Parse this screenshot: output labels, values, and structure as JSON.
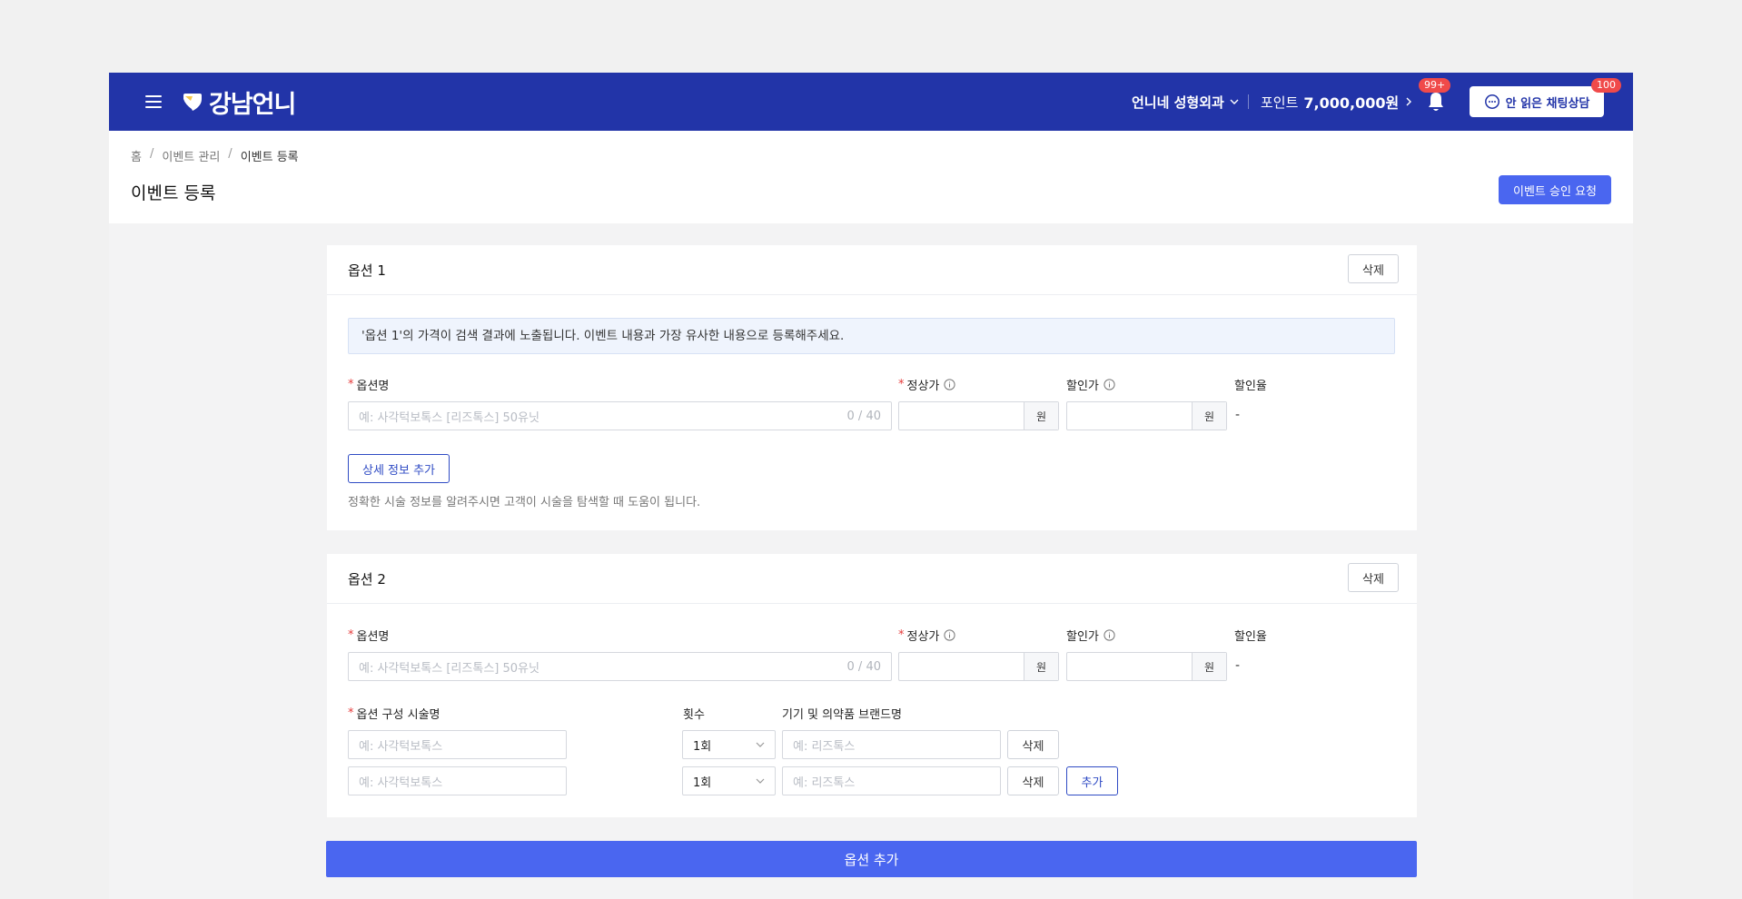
{
  "app": {
    "logo_text": "강남언니",
    "hospital_name": "언니네 성형외과",
    "points_label": "포인트",
    "points_value": "7,000,000원",
    "notifications_badge": "99+",
    "chat_button_label": "안 읽은 채팅상담",
    "chat_badge": "100",
    "accent_color": "#2234a8",
    "primary_button_color": "#4a66f0"
  },
  "breadcrumb": [
    "홈",
    "이벤트 관리",
    "이벤트 등록"
  ],
  "page": {
    "title": "이벤트 등록",
    "approve_button": "이벤트 승인 요청"
  },
  "option1": {
    "title": "옵션 1",
    "delete_label": "삭제",
    "notice": "'옵션 1'의 가격이 검색 결과에 노출됩니다. 이벤트 내용과 가장 유사한 내용으로 등록해주세요.",
    "name_label": "옵션명",
    "name_placeholder": "예: 사각턱보톡스 [리즈톡스] 50유닛",
    "name_counter": "0 / 40",
    "regular_price_label": "정상가",
    "discount_price_label": "할인가",
    "discount_rate_label": "할인율",
    "currency_unit": "원",
    "discount_rate_value": "-",
    "detail_button": "상세 정보 추가",
    "helper_text": "정확한 시술 정보를 알려주시면 고객이 시술을 탐색할 때 도움이 됩니다."
  },
  "option2": {
    "title": "옵션 2",
    "delete_label": "삭제",
    "name_label": "옵션명",
    "name_placeholder": "예: 사각턱보톡스 [리즈톡스] 50유닛",
    "name_counter": "0 / 40",
    "regular_price_label": "정상가",
    "discount_price_label": "할인가",
    "discount_rate_label": "할인율",
    "currency_unit": "원",
    "discount_rate_value": "-",
    "procedure_label": "옵션 구성 시술명",
    "count_label": "횟수",
    "brand_label": "기기 및 의약품 브랜드명",
    "rows": [
      {
        "procedure_placeholder": "예: 사각턱보톡스",
        "count": "1회",
        "brand_placeholder": "예: 리즈톡스",
        "delete_label": "삭제"
      },
      {
        "procedure_placeholder": "예: 사각턱보톡스",
        "count": "1회",
        "brand_placeholder": "예: 리즈톡스",
        "delete_label": "삭제",
        "add_label": "추가"
      }
    ]
  },
  "add_option_button": "옵션 추가"
}
